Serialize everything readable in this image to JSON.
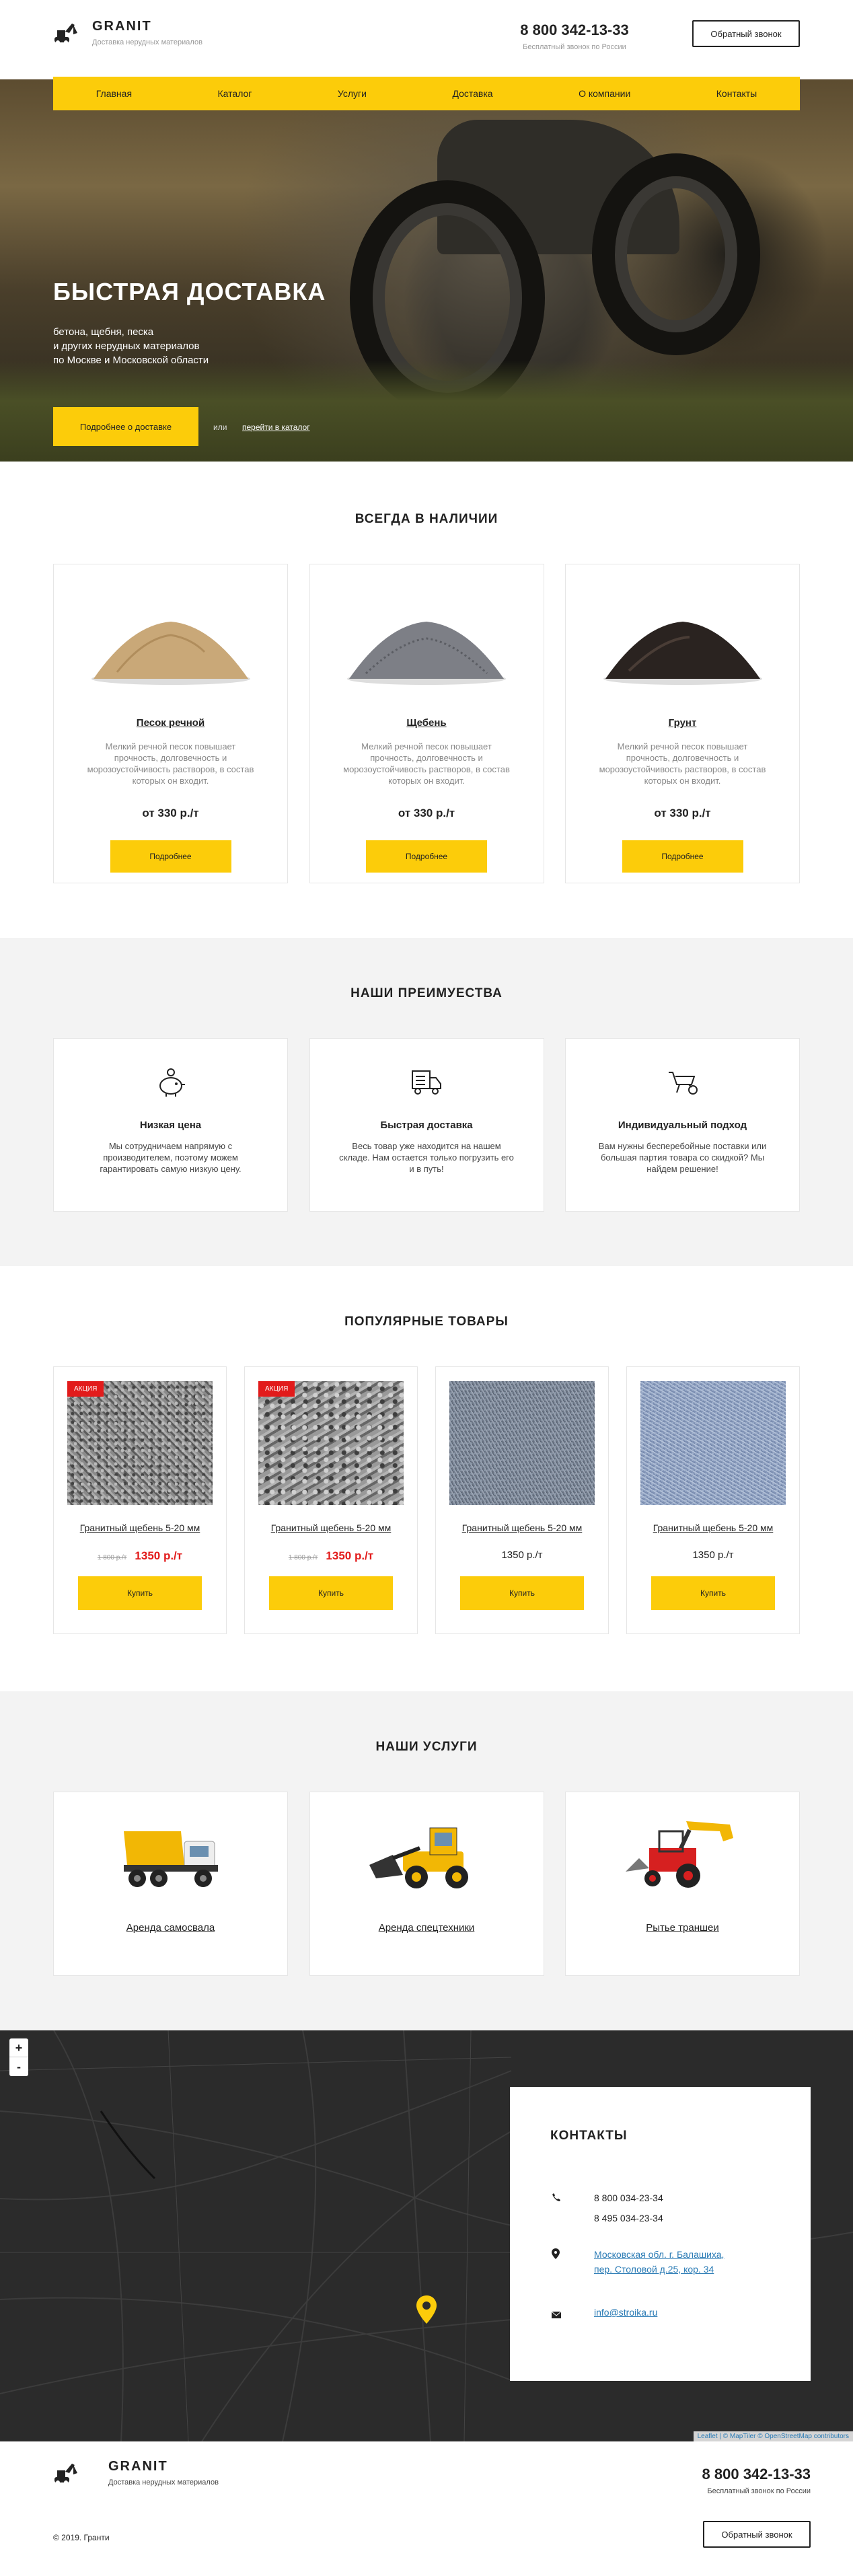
{
  "brand": {
    "name": "GRANIT",
    "tagline": "Доставка нерудных материалов"
  },
  "header": {
    "phone": "8 800 342-13-33",
    "phone_note": "Бесплатный звонок по России",
    "callback": "Обратный звонок"
  },
  "nav": [
    "Главная",
    "Каталог",
    "Услуги",
    "Доставка",
    "О компании",
    "Контакты"
  ],
  "hero": {
    "title": "БЫСТРАЯ ДОСТАВКА",
    "text_lines": [
      "бетона, щебня, песка",
      "и других нерудных материалов",
      "по Москве и Московской области"
    ],
    "button": "Подробнее о доставке",
    "or": "или",
    "catalog_link": "перейти в каталог"
  },
  "stock": {
    "title": "ВСЕГДА В НАЛИЧИИ",
    "items": [
      {
        "name": "Песок речной",
        "desc": "Мелкий речной песок повышает прочность, долговечность и морозоустойчивость растворов, в состав которых он входит.",
        "price": "от 330 р./т",
        "button": "Подробнее",
        "color": "#c9a878"
      },
      {
        "name": "Щебень",
        "desc": "Мелкий речной песок повышает прочность, долговечность и морозоустойчивость растворов, в состав которых он входит.",
        "price": "от 330 р./т",
        "button": "Подробнее",
        "color": "#7d7f86"
      },
      {
        "name": "Грунт",
        "desc": "Мелкий речной песок повышает прочность, долговечность и морозоустойчивость растворов, в состав которых он входит.",
        "price": "от 330 р./т",
        "button": "Подробнее",
        "color": "#2a2320"
      }
    ]
  },
  "advantages": {
    "title": "НАШИ ПРЕИМУЕСТВА",
    "items": [
      {
        "icon": "piggy-bank-icon",
        "title": "Низкая цена",
        "desc": "Мы сотрудничаем напрямую с производителем, поэтому можем гарантировать самую низкую цену."
      },
      {
        "icon": "delivery-truck-icon",
        "title": "Быстрая доставка",
        "desc": "Весь товар уже находится на нашем складе. Нам остается только погрузить его и в путь!"
      },
      {
        "icon": "wheelbarrow-icon",
        "title": "Индивидуальный подход",
        "desc": "Вам нужны бесперебойные поставки или большая партия товара со скидкой? Мы найдем решение!"
      }
    ]
  },
  "popular": {
    "title": "ПОПУЛЯРНЫЕ ТОВАРЫ",
    "items": [
      {
        "badge": "АКЦИЯ",
        "name": "Гранитный щебень 5-20 мм",
        "old_price": "1 800 р./т",
        "price": "1350 р./т",
        "button": "Купить"
      },
      {
        "badge": "АКЦИЯ",
        "name": "Гранитный щебень 5-20 мм",
        "old_price": "1 800 р./т",
        "price": "1350 р./т",
        "button": "Купить"
      },
      {
        "badge": "",
        "name": "Гранитный щебень 5-20 мм",
        "old_price": "",
        "price": "1350 р./т",
        "button": "Купить"
      },
      {
        "badge": "",
        "name": "Гранитный щебень 5-20 мм",
        "old_price": "",
        "price": "1350 р./т",
        "button": "Купить"
      }
    ]
  },
  "services": {
    "title": "НАШИ УСЛУГИ",
    "items": [
      {
        "name": "Аренда самосвала",
        "icon": "dump-truck-icon"
      },
      {
        "name": "Аренда спецтехники",
        "icon": "wheel-loader-icon"
      },
      {
        "name": "Рытье траншеи",
        "icon": "backhoe-loader-icon"
      }
    ]
  },
  "map": {
    "zoom_in": "+",
    "zoom_out": "-",
    "attribution": "Leaflet | © MapTiler © OpenStreetMap contributors"
  },
  "contacts": {
    "title": "КОНТАКТЫ",
    "phones": [
      "8 800 034-23-34",
      "8 495 034-23-34"
    ],
    "address": [
      "Московская обл. г. Балашиха,",
      "пер. Столовой д.25, кор. 34"
    ],
    "email": "info@stroika.ru"
  },
  "footer": {
    "copyright": "© 2019. Гранти",
    "phone": "8 800 342-13-33",
    "phone_note": "Бесплатный звонок по России",
    "callback": "Обратный звонок"
  },
  "colors": {
    "accent": "#fccc0a",
    "sale": "#e21b1b",
    "link": "#2a7bb5"
  }
}
